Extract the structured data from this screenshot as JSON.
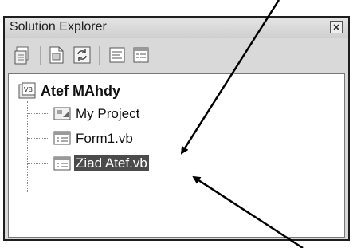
{
  "panel": {
    "title": "Solution Explorer",
    "close_icon": "close-icon"
  },
  "toolbar": {
    "buttons": [
      {
        "icon": "properties-icon"
      },
      {
        "icon": "show-all-files-icon"
      },
      {
        "icon": "refresh-icon"
      },
      {
        "icon": "view-code-icon"
      },
      {
        "icon": "view-designer-icon"
      }
    ]
  },
  "tree": {
    "project": {
      "label": "Atef MAhdy",
      "icon": "vb-project-icon"
    },
    "items": [
      {
        "label": "My Project",
        "icon": "my-project-icon"
      },
      {
        "label": "Form1.vb",
        "icon": "form-icon"
      },
      {
        "label": "Ziad Atef.vb",
        "icon": "form-icon",
        "selected": true
      }
    ]
  },
  "colors": {
    "selection_bg": "#4b4b4b",
    "panel_bg": "#d9d9d9",
    "arrow": "#000000"
  }
}
